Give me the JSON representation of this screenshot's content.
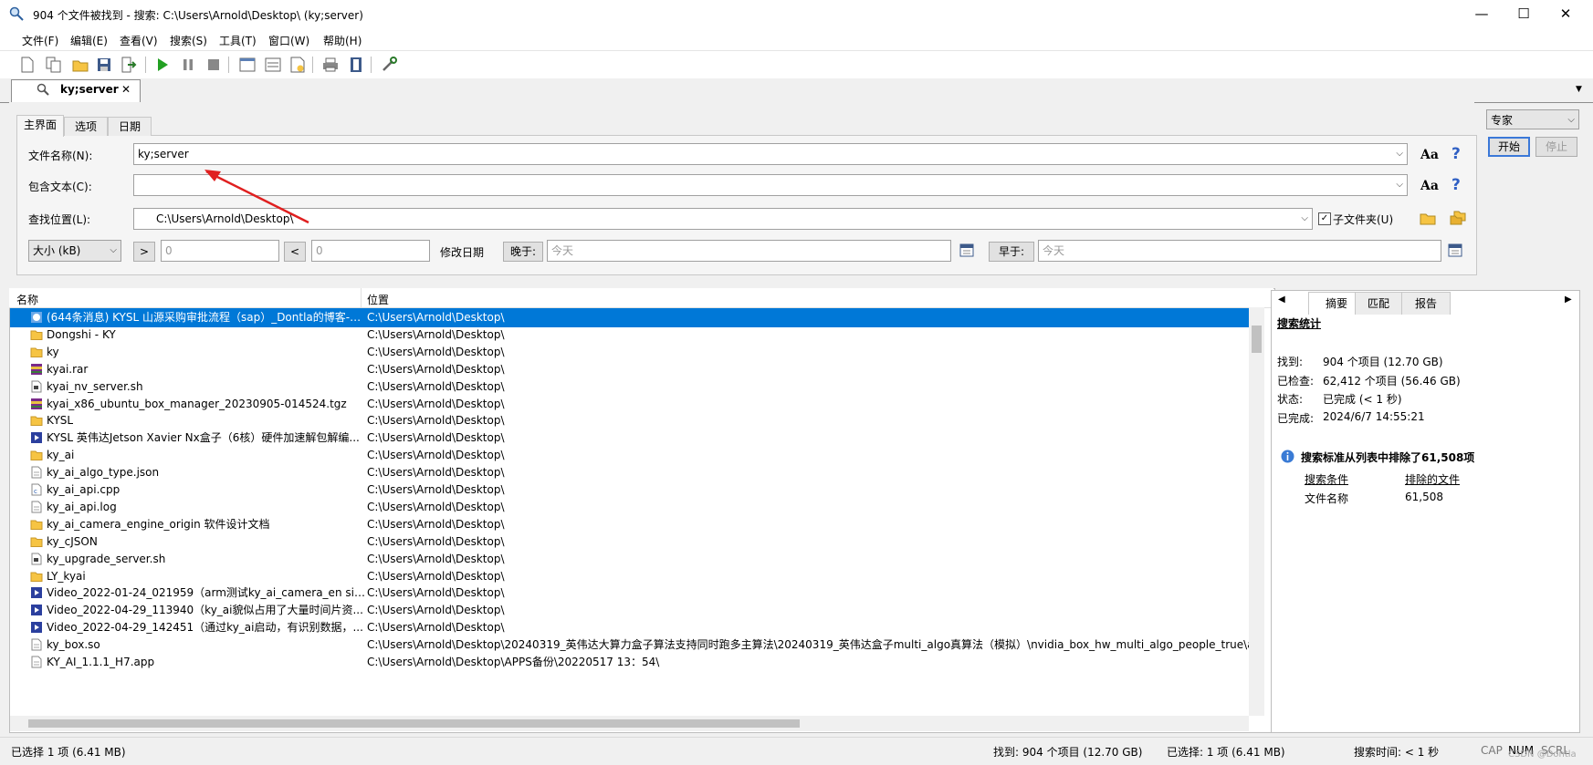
{
  "window": {
    "title": "904 个文件被找到 - 搜索: C:\\Users\\Arnold\\Desktop\\ (ky;server)",
    "minimize": "—",
    "maximize": "☐",
    "close": "✕"
  },
  "menu": [
    "文件(F)",
    "编辑(E)",
    "查看(V)",
    "搜索(S)",
    "工具(T)",
    "窗口(W)",
    "帮助(H)"
  ],
  "doc_tab": {
    "label": "ky;server",
    "close": "✕"
  },
  "search_tabs": [
    "主界面",
    "选项",
    "日期"
  ],
  "form": {
    "filename_label": "文件名称(N):",
    "filename_value": "ky;server",
    "content_label": "包含文本(C):",
    "content_value": "",
    "location_label": "查找位置(L):",
    "location_value": "C:\\Users\\Arnold\\Desktop\\",
    "subfolder_label": "子文件夹(U)",
    "subfolder_checked": true,
    "case_glyph": "Aa",
    "help_glyph": "?",
    "size_unit": "大小 (kB)",
    "gt": ">",
    "lt": "<",
    "size_min": "0",
    "size_max": "0",
    "modify_date_label": "修改日期",
    "later_label": "晚于:",
    "later_value": "今天",
    "earlier_label": "早于:",
    "earlier_value": "今天"
  },
  "right_controls": {
    "mode": "专家",
    "start": "开始",
    "stop": "停止"
  },
  "results": {
    "col_name": "名称",
    "col_location": "位置",
    "rows": [
      {
        "name": "(644条消息) KYSL 山源采购审批流程（sap）_Dontla的博客-C...",
        "loc": "C:\\Users\\Arnold\\Desktop\\",
        "icon": "web",
        "selected": true
      },
      {
        "name": "Dongshi - KY",
        "loc": "C:\\Users\\Arnold\\Desktop\\",
        "icon": "folder"
      },
      {
        "name": "ky",
        "loc": "C:\\Users\\Arnold\\Desktop\\",
        "icon": "folder"
      },
      {
        "name": "kyai.rar",
        "loc": "C:\\Users\\Arnold\\Desktop\\",
        "icon": "archive"
      },
      {
        "name": "kyai_nv_server.sh",
        "loc": "C:\\Users\\Arnold\\Desktop\\",
        "icon": "script"
      },
      {
        "name": "kyai_x86_ubuntu_box_manager_20230905-014524.tgz",
        "loc": "C:\\Users\\Arnold\\Desktop\\",
        "icon": "archive"
      },
      {
        "name": "KYSL",
        "loc": "C:\\Users\\Arnold\\Desktop\\",
        "icon": "folder"
      },
      {
        "name": "KYSL 英伟达Jetson Xavier Nx盒子（6核）硬件加速解包解编...",
        "loc": "C:\\Users\\Arnold\\Desktop\\",
        "icon": "video"
      },
      {
        "name": "ky_ai",
        "loc": "C:\\Users\\Arnold\\Desktop\\",
        "icon": "folder"
      },
      {
        "name": "ky_ai_algo_type.json",
        "loc": "C:\\Users\\Arnold\\Desktop\\",
        "icon": "text"
      },
      {
        "name": "ky_ai_api.cpp",
        "loc": "C:\\Users\\Arnold\\Desktop\\",
        "icon": "cpp"
      },
      {
        "name": "ky_ai_api.log",
        "loc": "C:\\Users\\Arnold\\Desktop\\",
        "icon": "text"
      },
      {
        "name": "ky_ai_camera_engine_origin 软件设计文档",
        "loc": "C:\\Users\\Arnold\\Desktop\\",
        "icon": "folder"
      },
      {
        "name": "ky_cJSON",
        "loc": "C:\\Users\\Arnold\\Desktop\\",
        "icon": "folder"
      },
      {
        "name": "ky_upgrade_server.sh",
        "loc": "C:\\Users\\Arnold\\Desktop\\",
        "icon": "script"
      },
      {
        "name": "LY_kyai",
        "loc": "C:\\Users\\Arnold\\Desktop\\",
        "icon": "folder"
      },
      {
        "name": "Video_2022-01-24_021959（arm测试ky_ai_camera_en sign...",
        "loc": "C:\\Users\\Arnold\\Desktop\\",
        "icon": "video"
      },
      {
        "name": "Video_2022-04-29_113940（ky_ai貌似占用了大量时间片资...",
        "loc": "C:\\Users\\Arnold\\Desktop\\",
        "icon": "video"
      },
      {
        "name": "Video_2022-04-29_142451（通过ky_ai启动，有识别数据，...",
        "loc": "C:\\Users\\Arnold\\Desktop\\",
        "icon": "video"
      },
      {
        "name": "ky_box.so",
        "loc": "C:\\Users\\Arnold\\Desktop\\20240319_英伟达大算力盒子算法支持同时跑多主算法\\20240319_英伟达盒子multi_algo真算法（模拟）\\nvidia_box_hw_multi_algo_people_true\\alg\\",
        "icon": "text"
      },
      {
        "name": "KY_AI_1.1.1_H7.app",
        "loc": "C:\\Users\\Arnold\\Desktop\\APPS备份\\20220517 13：54\\",
        "icon": "text"
      }
    ]
  },
  "side_panel": {
    "tabs": [
      "摘要",
      "匹配",
      "报告"
    ],
    "stats_title": "搜索统计",
    "found_label": "找到:",
    "found_value": "904 个项目 (12.70 GB)",
    "checked_label": "已检查:",
    "checked_value": "62,412 个项目 (56.46 GB)",
    "status_label": "状态:",
    "status_value": "已完成 (< 1 秒)",
    "done_label": "已完成:",
    "done_value": "2024/6/7 14:55:21",
    "excluded_msg": "搜索标准从列表中排除了61,508项",
    "col_criteria": "搜索条件",
    "col_excluded": "排除的文件",
    "criteria_value": "文件名称",
    "excluded_value": "61,508"
  },
  "status": {
    "selected_left": "已选择 1 项 (6.41 MB)",
    "found": "找到: 904 个项目 (12.70 GB)",
    "selected_mid": "已选择: 1 项 (6.41 MB)",
    "search_time": "搜索时间: < 1 秒",
    "caps": "CAP",
    "num": "NUM",
    "scrl": "SCRL",
    "watermark": "CSDN @Dontla"
  }
}
